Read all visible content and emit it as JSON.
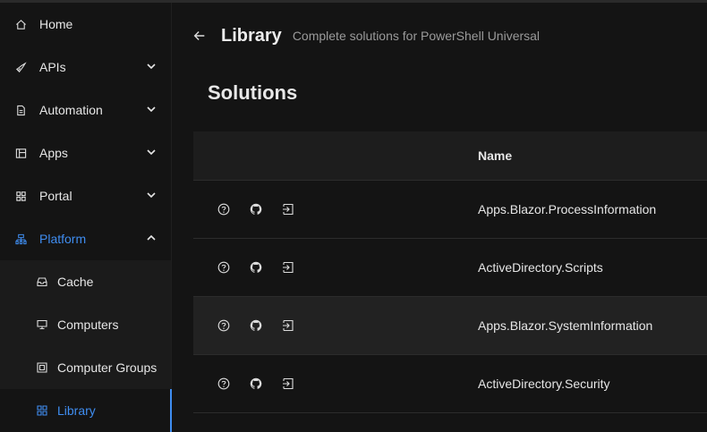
{
  "sidebar": {
    "items": [
      {
        "label": "Home",
        "icon": "home-icon"
      },
      {
        "label": "APIs",
        "icon": "rocket-icon"
      },
      {
        "label": "Automation",
        "icon": "file-icon"
      },
      {
        "label": "Apps",
        "icon": "layout-icon"
      },
      {
        "label": "Portal",
        "icon": "grid-icon"
      },
      {
        "label": "Platform",
        "icon": "cluster-icon"
      }
    ],
    "platform_children": [
      {
        "label": "Cache",
        "icon": "inbox-icon"
      },
      {
        "label": "Computers",
        "icon": "desktop-icon"
      },
      {
        "label": "Computer Groups",
        "icon": "group-icon"
      },
      {
        "label": "Library",
        "icon": "appstore-icon"
      }
    ]
  },
  "header": {
    "title": "Library",
    "subtitle": "Complete solutions for PowerShell Universal"
  },
  "section": {
    "title": "Solutions"
  },
  "table": {
    "columns": {
      "name": "Name"
    },
    "rows": [
      {
        "name": "Apps.Blazor.ProcessInformation"
      },
      {
        "name": "ActiveDirectory.Scripts"
      },
      {
        "name": "Apps.Blazor.SystemInformation"
      },
      {
        "name": "ActiveDirectory.Security"
      }
    ]
  },
  "colors": {
    "accent": "#3f8df0",
    "background": "#141414",
    "header_row": "#1d1d1d",
    "hover_row": "#222222"
  }
}
